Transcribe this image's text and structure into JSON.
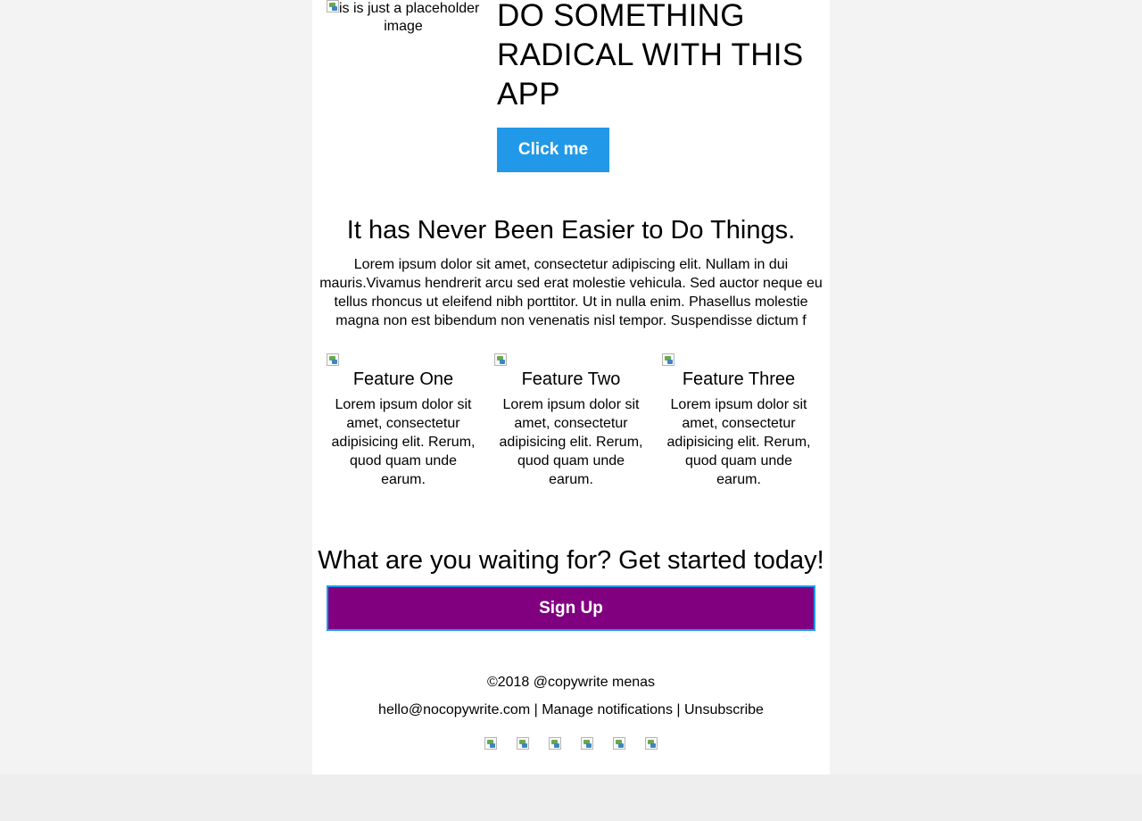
{
  "hero": {
    "image_alt": "this is just a placeholder image",
    "title": "DO SOMETHING RADICAL WITH THIS APP",
    "cta_label": "Click me"
  },
  "intro": {
    "title": "It has Never Been Easier to Do Things.",
    "text": "Lorem ipsum dolor sit amet, consectetur adipiscing elit. Nullam in dui mauris.Vivamus hendrerit arcu sed erat molestie vehicula. Sed auctor neque eu tellus rhoncus ut eleifend nibh porttitor. Ut in nulla enim. Phasellus molestie magna non est bibendum non venenatis nisl tempor. Suspendisse dictum f"
  },
  "features": [
    {
      "title": "Feature One",
      "text": "Lorem ipsum dolor sit amet, consectetur adipisicing elit. Rerum, quod quam unde earum."
    },
    {
      "title": "Feature Two",
      "text": "Lorem ipsum dolor sit amet, consectetur adipisicing elit. Rerum, quod quam unde earum."
    },
    {
      "title": "Feature Three",
      "text": "Lorem ipsum dolor sit amet, consectetur adipisicing elit. Rerum, quod quam unde earum."
    }
  ],
  "signup": {
    "title": "What are you waiting for? Get started today!",
    "button_label": "Sign Up"
  },
  "footer": {
    "copyright": "©2018 @copywrite menas",
    "email": "hello@nocopywrite.com",
    "separator": " | ",
    "manage_label": "Manage notifications",
    "unsubscribe_label": "Unsubscribe"
  },
  "icons": {
    "broken_image": "broken-image-icon",
    "social_count": 6
  },
  "colors": {
    "primary": "#2199e8",
    "signup_bg": "#800080",
    "page_bg": "#f3f3f3",
    "card_bg": "#ffffff"
  }
}
